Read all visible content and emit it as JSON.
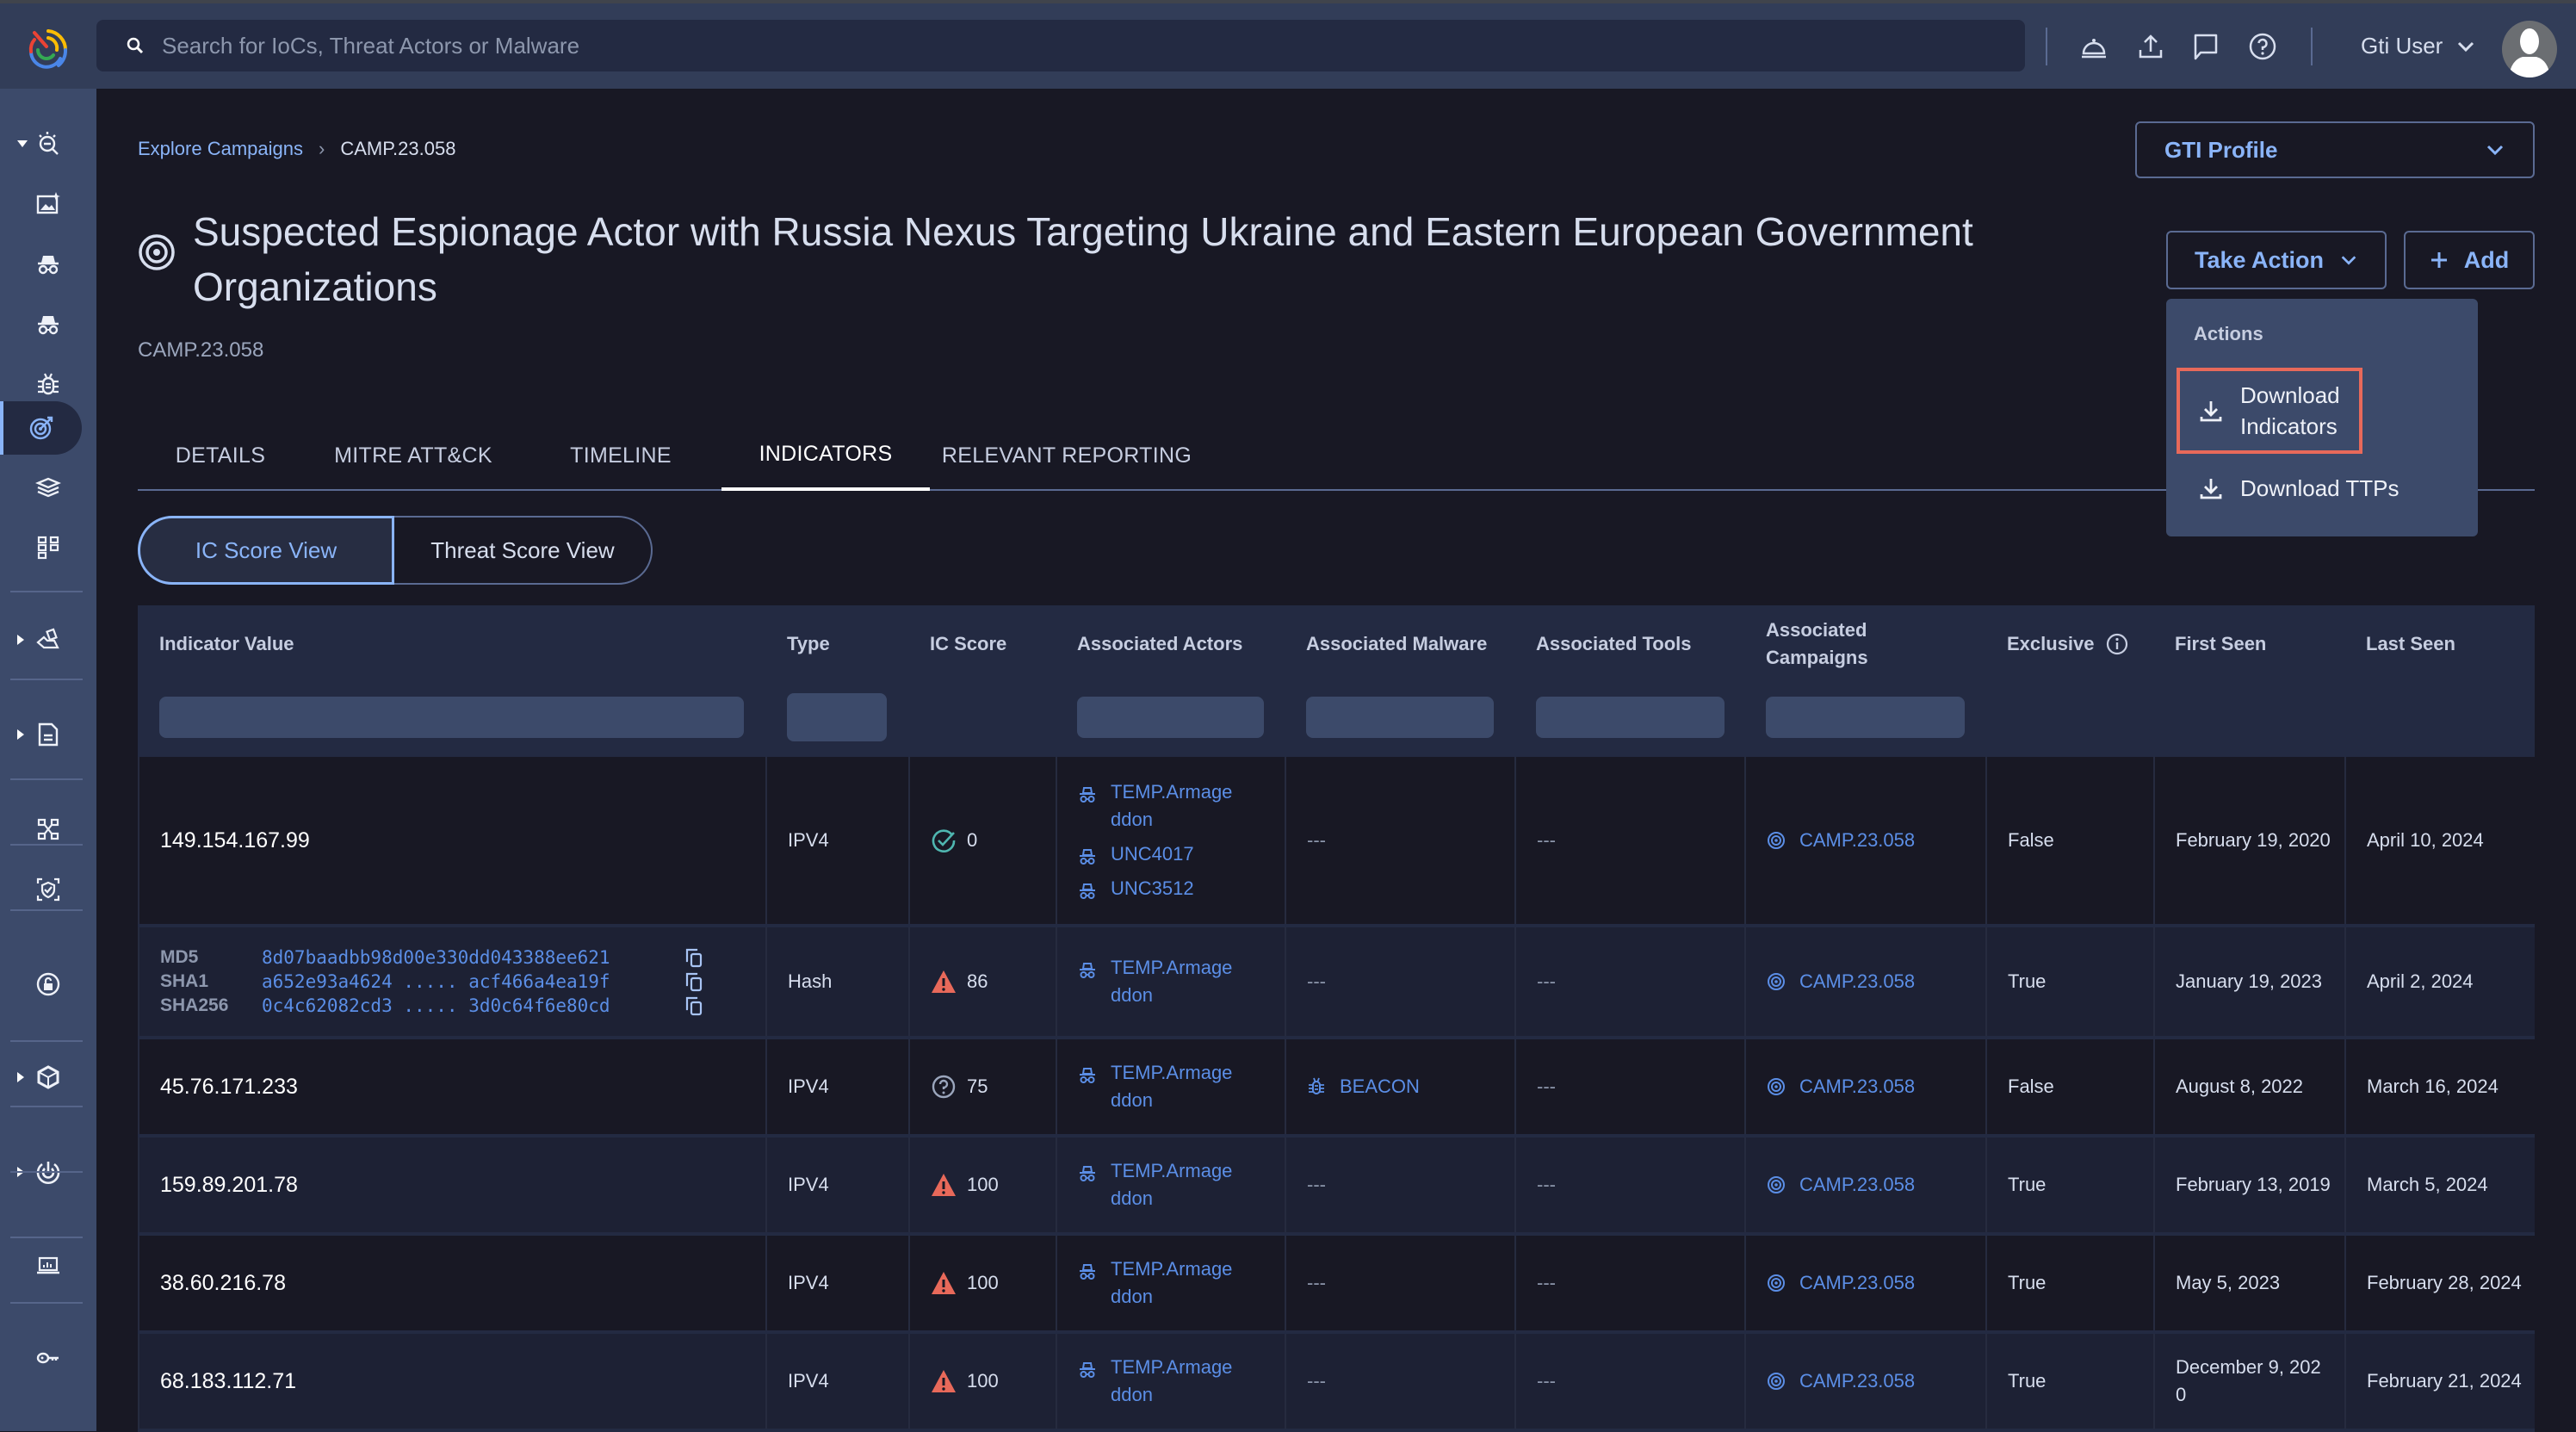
{
  "topbar": {
    "search_placeholder": "Search for IoCs, Threat Actors or Malware",
    "icons": [
      "notifications-bell-icon",
      "upload-icon",
      "feedback-chat-icon",
      "help-icon"
    ],
    "user_name": "Gti User"
  },
  "sidebar": {
    "items": [
      {
        "icon": "threat-hunt-icon",
        "expandable": true,
        "expanded": true
      },
      {
        "icon": "ai-image-icon"
      },
      {
        "icon": "threat-actor-icon"
      },
      {
        "icon": "threat-actor-alt-icon"
      },
      {
        "icon": "malware-bug-icon"
      },
      {
        "icon": "campaign-target-icon",
        "active": true
      },
      {
        "icon": "reports-stack-icon"
      },
      {
        "icon": "network-graph-icon"
      },
      {
        "icon": "vulnerability-hand-icon",
        "expandable": true
      },
      {
        "icon": "document-icon",
        "expandable": true
      },
      {
        "icon": "collections-icon"
      },
      {
        "icon": "shield-scan-icon"
      },
      {
        "icon": "unlock-icon"
      },
      {
        "icon": "hexagon-cube-icon",
        "expandable": true
      },
      {
        "icon": "radar-icon",
        "expandable": true
      },
      {
        "icon": "laptop-chart-icon"
      },
      {
        "icon": "api-key-icon"
      }
    ]
  },
  "breadcrumb": {
    "parent": "Explore Campaigns",
    "current": "CAMP.23.058"
  },
  "page": {
    "title": "Suspected Espionage Actor with Russia Nexus Targeting Ukraine and Eastern European Government Organizations",
    "id": "CAMP.23.058"
  },
  "profile_select": {
    "value": "GTI Profile"
  },
  "actions": {
    "take_action_label": "Take Action",
    "add_label": "Add",
    "menu": {
      "header": "Actions",
      "items": [
        {
          "label_line1": "Download",
          "label_line2": "Indicators",
          "highlighted": true
        },
        {
          "label": "Download TTPs"
        }
      ]
    }
  },
  "tabs": [
    {
      "label": "DETAILS"
    },
    {
      "label": "MITRE ATT&CK"
    },
    {
      "label": "TIMELINE"
    },
    {
      "label": "INDICATORS",
      "active": true
    },
    {
      "label": "RELEVANT REPORTING"
    }
  ],
  "view_toggle": {
    "selected": "IC Score View",
    "options": [
      "IC Score View",
      "Threat Score View"
    ]
  },
  "table": {
    "columns": [
      {
        "label": "Indicator Value",
        "filter": true
      },
      {
        "label": "Type",
        "filter": true
      },
      {
        "label": "IC Score",
        "filter": false
      },
      {
        "label": "Associated Actors",
        "filter": true
      },
      {
        "label": "Associated Malware",
        "filter": true
      },
      {
        "label": "Associated Tools",
        "filter": true
      },
      {
        "label": "Associated Campaigns",
        "filter": true
      },
      {
        "label": "Exclusive",
        "filter": false,
        "info_icon": true
      },
      {
        "label": "First Seen",
        "filter": false
      },
      {
        "label": "Last Seen",
        "filter": false
      }
    ],
    "rows": [
      {
        "indicator": "149.154.167.99",
        "type": "IPV4",
        "score": "0",
        "score_icon": "check-circle",
        "actors": [
          "TEMP.Armageddon",
          "UNC4017",
          "UNC3512"
        ],
        "malware": "---",
        "tools": "---",
        "campaign": "CAMP.23.058",
        "exclusive": "False",
        "first_seen": "February 19, 2020",
        "last_seen": "April 10, 2024"
      },
      {
        "indicator_type": "hash",
        "hashes": [
          {
            "label": "MD5",
            "value": "8d07baadbb98d00e330dd043388ee621"
          },
          {
            "label": "SHA1",
            "value": "a652e93a4624 ..... acf466a4ea19f"
          },
          {
            "label": "SHA256",
            "value": "0c4c62082cd3 ..... 3d0c64f6e80cd"
          }
        ],
        "type": "Hash",
        "score": "86",
        "score_icon": "warning-triangle",
        "actors": [
          "TEMP.Armageddon"
        ],
        "malware": "---",
        "tools": "---",
        "campaign": "CAMP.23.058",
        "exclusive": "True",
        "first_seen": "January 19, 2023",
        "last_seen": "April 2, 2024"
      },
      {
        "indicator": "45.76.171.233",
        "type": "IPV4",
        "score": "75",
        "score_icon": "question-circle",
        "actors": [
          "TEMP.Armageddon"
        ],
        "malware": "BEACON",
        "tools": "---",
        "campaign": "CAMP.23.058",
        "exclusive": "False",
        "first_seen": "August 8, 2022",
        "last_seen": "March 16, 2024"
      },
      {
        "indicator": "159.89.201.78",
        "type": "IPV4",
        "score": "100",
        "score_icon": "warning-triangle",
        "actors": [
          "TEMP.Armageddon"
        ],
        "malware": "---",
        "tools": "---",
        "campaign": "CAMP.23.058",
        "exclusive": "True",
        "first_seen": "February 13, 2019",
        "last_seen": "March 5, 2024"
      },
      {
        "indicator": "38.60.216.78",
        "type": "IPV4",
        "score": "100",
        "score_icon": "warning-triangle",
        "actors": [
          "TEMP.Armageddon"
        ],
        "malware": "---",
        "tools": "---",
        "campaign": "CAMP.23.058",
        "exclusive": "True",
        "first_seen": "May 5, 2023",
        "last_seen": "February 28, 2024"
      },
      {
        "indicator": "68.183.112.71",
        "type": "IPV4",
        "score": "100",
        "score_icon": "warning-triangle",
        "actors": [
          "TEMP.Armageddon"
        ],
        "malware": "---",
        "tools": "---",
        "campaign": "CAMP.23.058",
        "exclusive": "True",
        "first_seen": "December 9, 2020",
        "last_seen": "February 21, 2024"
      }
    ]
  },
  "colors": {
    "accent": "#8ab4f8",
    "link": "#5b8ee6",
    "warning": "#e8695a",
    "ok": "#4fb6b0",
    "highlight_border": "#e8695a"
  }
}
